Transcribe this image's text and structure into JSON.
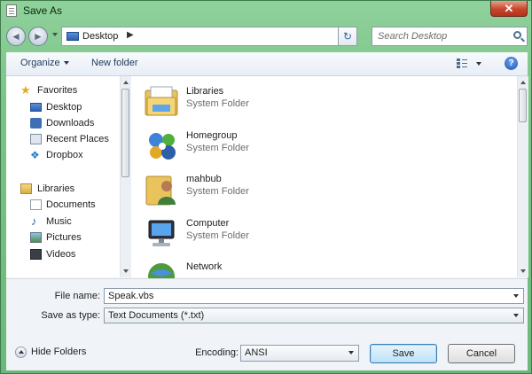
{
  "window": {
    "title": "Save As",
    "close_glyph": "✕"
  },
  "nav": {
    "back_glyph": "◄",
    "forward_glyph": "►",
    "address": "Desktop",
    "address_chevron": "▶",
    "refresh_glyph": "↻",
    "search_placeholder": "Search Desktop"
  },
  "toolbar": {
    "organize": "Organize",
    "new_folder": "New folder",
    "help_glyph": "?"
  },
  "sidebar": {
    "favorites_header": "Favorites",
    "favorites": [
      "Desktop",
      "Downloads",
      "Recent Places",
      "Dropbox"
    ],
    "libraries_header": "Libraries",
    "libraries": [
      "Documents",
      "Music",
      "Pictures",
      "Videos"
    ]
  },
  "files": [
    {
      "name": "Libraries",
      "type": "System Folder"
    },
    {
      "name": "Homegroup",
      "type": "System Folder"
    },
    {
      "name": "mahbub",
      "type": "System Folder"
    },
    {
      "name": "Computer",
      "type": "System Folder"
    },
    {
      "name": "Network",
      "type": ""
    }
  ],
  "form": {
    "file_name_label": "File name:",
    "file_name_value": "Speak.vbs",
    "save_type_label": "Save as type:",
    "save_type_value": "Text Documents (*.txt)",
    "encoding_label": "Encoding:",
    "encoding_value": "ANSI"
  },
  "buttons": {
    "hide_folders": "Hide Folders",
    "save": "Save",
    "cancel": "Cancel"
  },
  "colors": {
    "accent": "#3c7fb1",
    "frame": "#79c386",
    "close": "#c7472c"
  }
}
